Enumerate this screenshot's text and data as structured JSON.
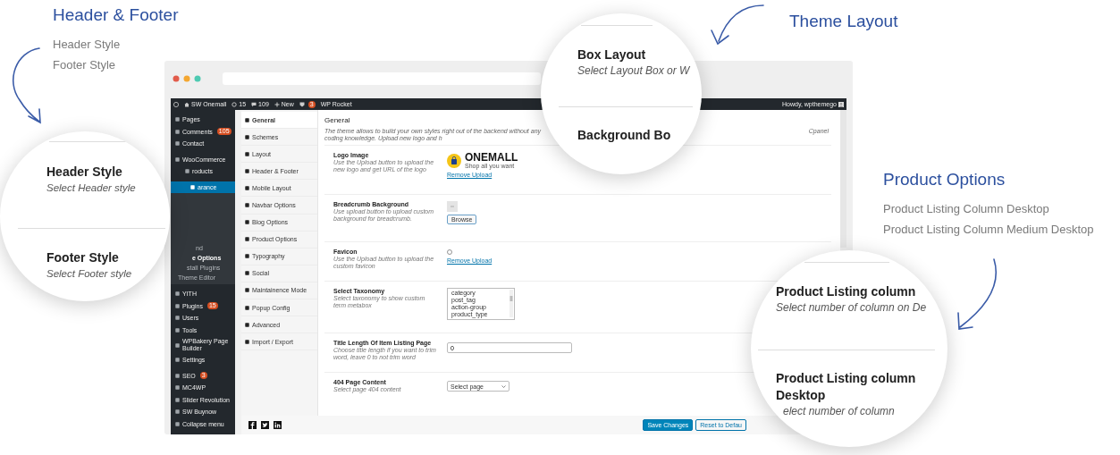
{
  "callouts": [
    {
      "title": "Header & Footer",
      "items": [
        "Header Style",
        "Footer Style"
      ]
    },
    {
      "title": "Theme Layout"
    },
    {
      "title": "Product Options",
      "items": [
        "Product Listing Column Desktop",
        "Product Listing Column Medium Desktop"
      ]
    }
  ],
  "zoom_circles": [
    {
      "fields": [
        {
          "title": "Header Style",
          "hint": "Select Header style"
        },
        {
          "title": "Footer Style",
          "hint": "Select Footer style"
        }
      ]
    },
    {
      "fields": [
        {
          "title": "Box Layout",
          "hint": "Select Layout Box or W"
        },
        {
          "title": "Background Bo"
        }
      ]
    },
    {
      "fields": [
        {
          "title": "Product Listing column",
          "hint": "Select number of column on De"
        },
        {
          "title": "Product Listing column Desktop",
          "hint": "elect number of column"
        }
      ]
    }
  ],
  "admin_bar": {
    "site": "SW Onemall",
    "updates": "15",
    "comments": "109",
    "new": "New",
    "plugin_badge": "3",
    "plugin": "WP Rocket",
    "greeting": "Howdy, wpthemego"
  },
  "sidebar": [
    {
      "label": "Pages",
      "selected": false
    },
    {
      "label": "Comments",
      "badge": "105",
      "selected": false
    },
    {
      "label": "Contact",
      "selected": false
    },
    {
      "label": "WooCommerce",
      "selected": false
    },
    {
      "label": "roducts",
      "selected": false
    },
    {
      "label": "arance",
      "selected": true,
      "children": [
        {
          "label": "nd",
          "selected": false
        },
        {
          "label": "e Options",
          "selected": true
        },
        {
          "label": "stall Plugins",
          "selected": false
        },
        {
          "label": "Theme Editor",
          "selected": false
        }
      ]
    },
    {
      "label": "YITH",
      "selected": false
    },
    {
      "label": "Plugins",
      "badge": "15",
      "selected": false
    },
    {
      "label": "Users",
      "selected": false
    },
    {
      "label": "Tools",
      "selected": false
    },
    {
      "label": "WPBakery Page Builder",
      "selected": false
    },
    {
      "label": "Settings",
      "selected": false
    },
    {
      "label": "SEO",
      "badge": "3",
      "selected": false
    },
    {
      "label": "MC4WP",
      "selected": false
    },
    {
      "label": "Slider Revolution",
      "selected": false
    },
    {
      "label": "SW Buynow",
      "selected": false
    },
    {
      "label": "Collapse menu",
      "selected": false
    }
  ],
  "tabs": [
    {
      "label": "General",
      "selected": true
    },
    {
      "label": "Schemes",
      "selected": false
    },
    {
      "label": "Layout",
      "selected": false
    },
    {
      "label": "Header & Footer",
      "selected": false
    },
    {
      "label": "Mobile Layout",
      "selected": false
    },
    {
      "label": "Navbar Options",
      "selected": false
    },
    {
      "label": "Blog Options",
      "selected": false
    },
    {
      "label": "Product Options",
      "selected": false
    },
    {
      "label": "Typography",
      "selected": false
    },
    {
      "label": "Social",
      "selected": false
    },
    {
      "label": "Maintainence Mode",
      "selected": false
    },
    {
      "label": "Popup Config",
      "selected": false
    },
    {
      "label": "Advanced",
      "selected": false
    },
    {
      "label": "Import / Export",
      "selected": false
    }
  ],
  "panel": {
    "title": "General",
    "intro": "The theme allows to build your own styles right out of the backend without any coding knowledge. Upload new logo and h",
    "link": "Cpanel",
    "fields": [
      {
        "kind": "logo",
        "label": "Logo Image",
        "desc": "Use the Upload button to upload the new logo and get URL of the logo",
        "brand": "ONEMALL",
        "tagline": "Shop all you want",
        "action": "Remove Upload"
      },
      {
        "kind": "image",
        "label": "Breadcrumb Background",
        "desc": "Use upload button to upload custom background for breadcrumb.",
        "button": "Browse"
      },
      {
        "kind": "favicon",
        "label": "Favicon",
        "desc": "Use the Upload button to upload the custom favicon",
        "action": "Remove Upload"
      },
      {
        "kind": "listbox",
        "label": "Select Taxonomy",
        "desc": "Select taxonomy to show custom term metabox",
        "options": [
          "category",
          "post_tag",
          "action-group",
          "product_type"
        ]
      },
      {
        "kind": "text",
        "label": "Title Length Of Item Listing Page",
        "desc": "Choose title length if you want to trim word, leave 0 to not trim word",
        "value": "0"
      },
      {
        "kind": "select",
        "label": "404 Page Content",
        "desc": "Select page 404 content",
        "value": "Select page"
      }
    ]
  },
  "footer": {
    "buttons": [
      {
        "label": "Save Changes",
        "primary": true
      },
      {
        "label": "Reset to Defau",
        "primary": false
      }
    ]
  }
}
